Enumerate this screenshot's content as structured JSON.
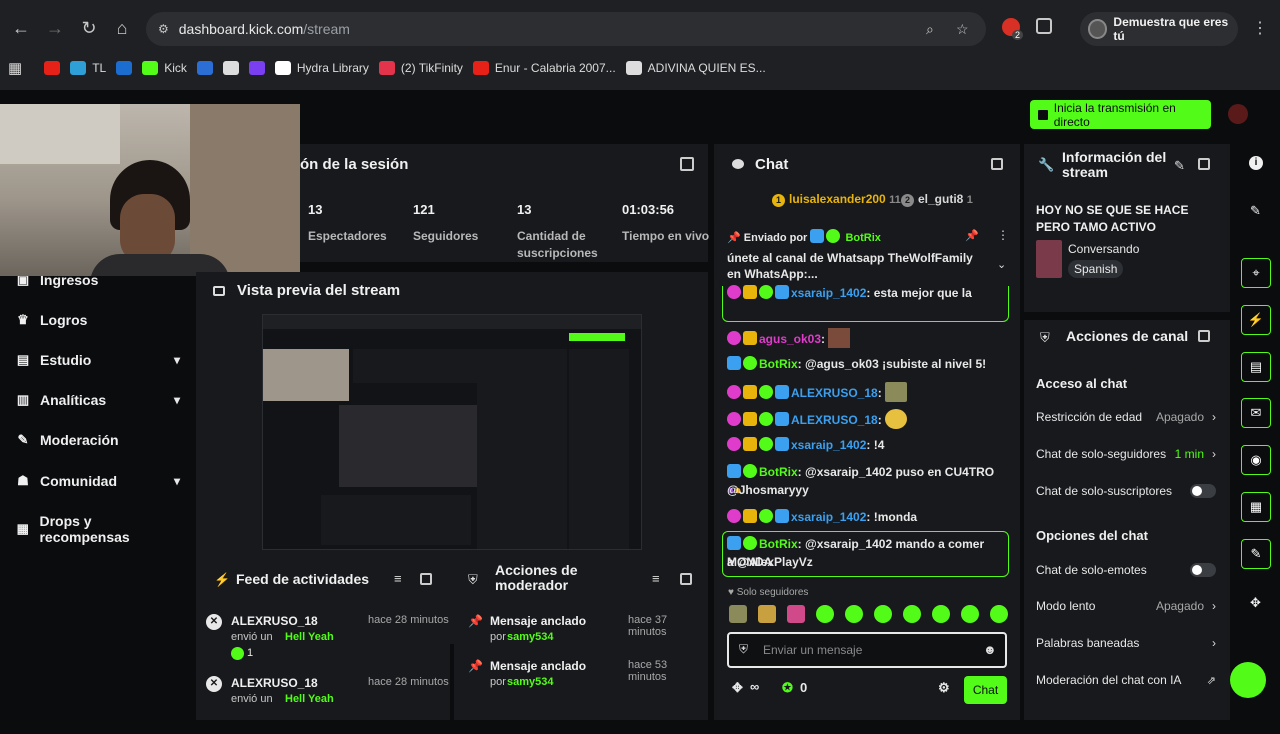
{
  "browser": {
    "url_host": "dashboard.kick.com",
    "url_path": "/stream",
    "profile_label": "Demuestra que eres tú",
    "extension_badge": "2",
    "bookmarks": [
      {
        "label": "",
        "color": "#e62117"
      },
      {
        "label": "TL",
        "color": "#2f9fd8"
      },
      {
        "label": "",
        "color": "#1c6dd0"
      },
      {
        "label": "Kick",
        "color": "#53fc18"
      },
      {
        "label": "",
        "color": "#2b6fd6"
      },
      {
        "label": "",
        "color": "#dddddd"
      },
      {
        "label": "",
        "color": "#7b3ff2"
      },
      {
        "label": "Hydra Library",
        "color": "#ffffff"
      },
      {
        "label": "(2) TikFinity",
        "color": "#e3344c"
      },
      {
        "label": "Enur - Calabria 2007...",
        "color": "#e62117"
      },
      {
        "label": "ADIVINA QUIEN ES...",
        "color": "#dddddd"
      }
    ]
  },
  "header": {
    "go_live_label": "Inicia la transmisión en directo"
  },
  "session": {
    "title": "ón de la sesión",
    "stats": [
      {
        "value": "13",
        "label": "Espectadores"
      },
      {
        "value": "121",
        "label": "Seguidores"
      },
      {
        "value": "13",
        "label": "Cantidad de suscripciones"
      },
      {
        "value": "01:03:56",
        "label": "Tiempo en vivo"
      }
    ]
  },
  "sidebar": {
    "items": [
      {
        "label": "Ingresos",
        "icon": "money-icon",
        "chevron": false
      },
      {
        "label": "Logros",
        "icon": "trophy-icon",
        "chevron": false
      },
      {
        "label": "Estudio",
        "icon": "studio-icon",
        "chevron": true
      },
      {
        "label": "Analíticas",
        "icon": "analytics-icon",
        "chevron": true
      },
      {
        "label": "Moderación",
        "icon": "wrench-icon",
        "chevron": false
      },
      {
        "label": "Comunidad",
        "icon": "community-icon",
        "chevron": true
      },
      {
        "label": "Drops y recompensas",
        "icon": "gift-icon",
        "chevron": false
      }
    ]
  },
  "preview": {
    "title": "Vista previa del stream"
  },
  "activity": {
    "title": "Feed de actividades",
    "items": [
      {
        "user": "ALEXRUSO_18",
        "action": "envió un",
        "item": "Hell Yeah",
        "time": "hace 28 minutos",
        "count": "1"
      },
      {
        "user": "ALEXRUSO_18",
        "action": "envió un",
        "item": "Hell Yeah",
        "time": "hace 28 minutos",
        "count": ""
      }
    ]
  },
  "modactions": {
    "title": "Acciones de moderador",
    "items": [
      {
        "action": "Mensaje anclado",
        "by": "por",
        "user": "samy534",
        "time": "hace 37 minutos"
      },
      {
        "action": "Mensaje anclado",
        "by": "por",
        "user": "samy534",
        "time": "hace 53 minutos"
      }
    ]
  },
  "chat": {
    "title": "Chat",
    "top_gifters": [
      {
        "name": "luisalexander200",
        "count": "11",
        "rank": "1"
      },
      {
        "name": "el_guti8",
        "count": "1",
        "rank": "2"
      }
    ],
    "pinned": {
      "sent_by_label": "Enviado por",
      "user": "BotRix",
      "message": "únete al canal de Whatsapp TheWolfFamily en WhatsApp:..."
    },
    "messages": [
      {
        "user": "xsaraip_1402",
        "text": "esta mejor que la",
        "color": "#3ba0f0"
      },
      {
        "user": "agus_ok03",
        "text": "",
        "color": "#e03ccb"
      },
      {
        "user": "BotRix",
        "text": "@agus_ok03 ¡subiste al nivel 5!",
        "color": "#53fc18"
      },
      {
        "user": "ALEXRUSO_18",
        "text": "",
        "color": "#3ba0f0"
      },
      {
        "user": "ALEXRUSO_18",
        "text": "",
        "color": "#3ba0f0"
      },
      {
        "user": "xsaraip_1402",
        "text": "!4",
        "color": "#3ba0f0"
      },
      {
        "user": "BotRix",
        "text": "@xsaraip_1402 puso en CU4TRO",
        "color": "#53fc18"
      },
      {
        "user": "",
        "text": "@Jhosmaryyy",
        "color": "#e8e8e8"
      },
      {
        "user": "xsaraip_1402",
        "text": "!monda",
        "color": "#3ba0f0"
      },
      {
        "user": "BotRix",
        "text": "@xsaraip_1402 mando a comer MONDA",
        "color": "#53fc18"
      },
      {
        "user": "",
        "text": "a @AlexPlayVz",
        "color": "#e8e8e8"
      }
    ],
    "followers_only_label": "Solo seguidores",
    "input_placeholder": "Enviar un mensaje",
    "infinity_label": "∞",
    "points": "0",
    "send_label": "Chat"
  },
  "stream_info": {
    "title": "Información del stream",
    "stream_title": "HOY NO SE QUE SE HACE PERO TAMO ACTIVO",
    "category": "Conversando",
    "language": "Spanish"
  },
  "channel_actions": {
    "title": "Acciones de canal",
    "section_chat_access": "Acceso al chat",
    "section_chat_options": "Opciones del chat",
    "rows": [
      {
        "label": "Restricción de edad",
        "value": "Apagado"
      },
      {
        "label": "Chat de solo-seguidores",
        "value": "1 min"
      },
      {
        "label": "Chat de solo-suscriptores",
        "value": ""
      },
      {
        "label": "Chat de solo-emotes",
        "value": ""
      },
      {
        "label": "Modo lento",
        "value": "Apagado"
      },
      {
        "label": "Palabras baneadas",
        "value": ""
      },
      {
        "label": "Moderación del chat con IA",
        "value": ""
      }
    ]
  }
}
